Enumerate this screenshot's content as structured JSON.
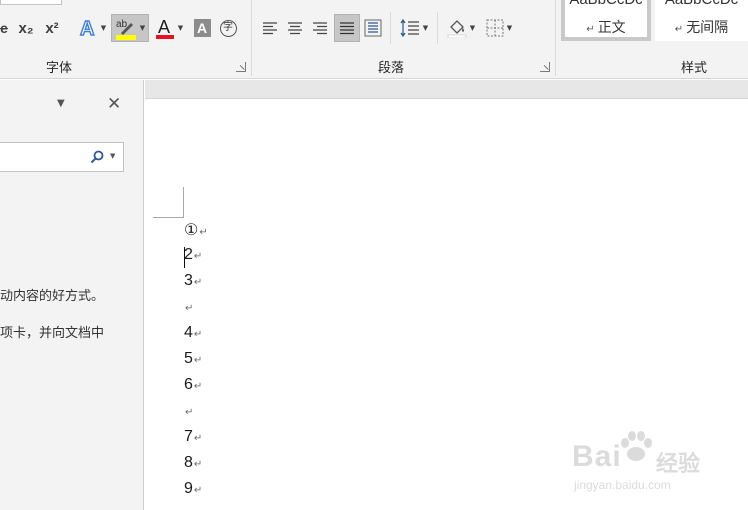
{
  "ribbon": {
    "font_group": {
      "label": "字体",
      "subscript_label": "x₂",
      "superscript_label": "x²",
      "font_color_hex": "#e81123",
      "highlight_color_hex": "#ffff00",
      "shading_label": "A",
      "font_color_label": "A",
      "enclosed_char_label": "字"
    },
    "paragraph_group": {
      "label": "段落"
    },
    "styles_group": {
      "label": "样式",
      "styles": [
        {
          "preview": "AaBbCcDc",
          "name": "正文"
        },
        {
          "preview": "AaBbCcDc",
          "name": "无间隔"
        }
      ]
    }
  },
  "nav_pane": {
    "close_symbol": "✕",
    "search_value": "",
    "text_line_1": "动内容的好方式。",
    "text_line_2": "项卡，并向文档中"
  },
  "document": {
    "paragraph_mark": "↵",
    "lines": [
      "①",
      "2",
      "3",
      "",
      "4",
      "5",
      "6",
      "",
      "7",
      "8",
      "9"
    ]
  },
  "watermark": {
    "brand": "Bai",
    "brand_suffix": "经验",
    "url": "jingyan.baidu.com"
  }
}
